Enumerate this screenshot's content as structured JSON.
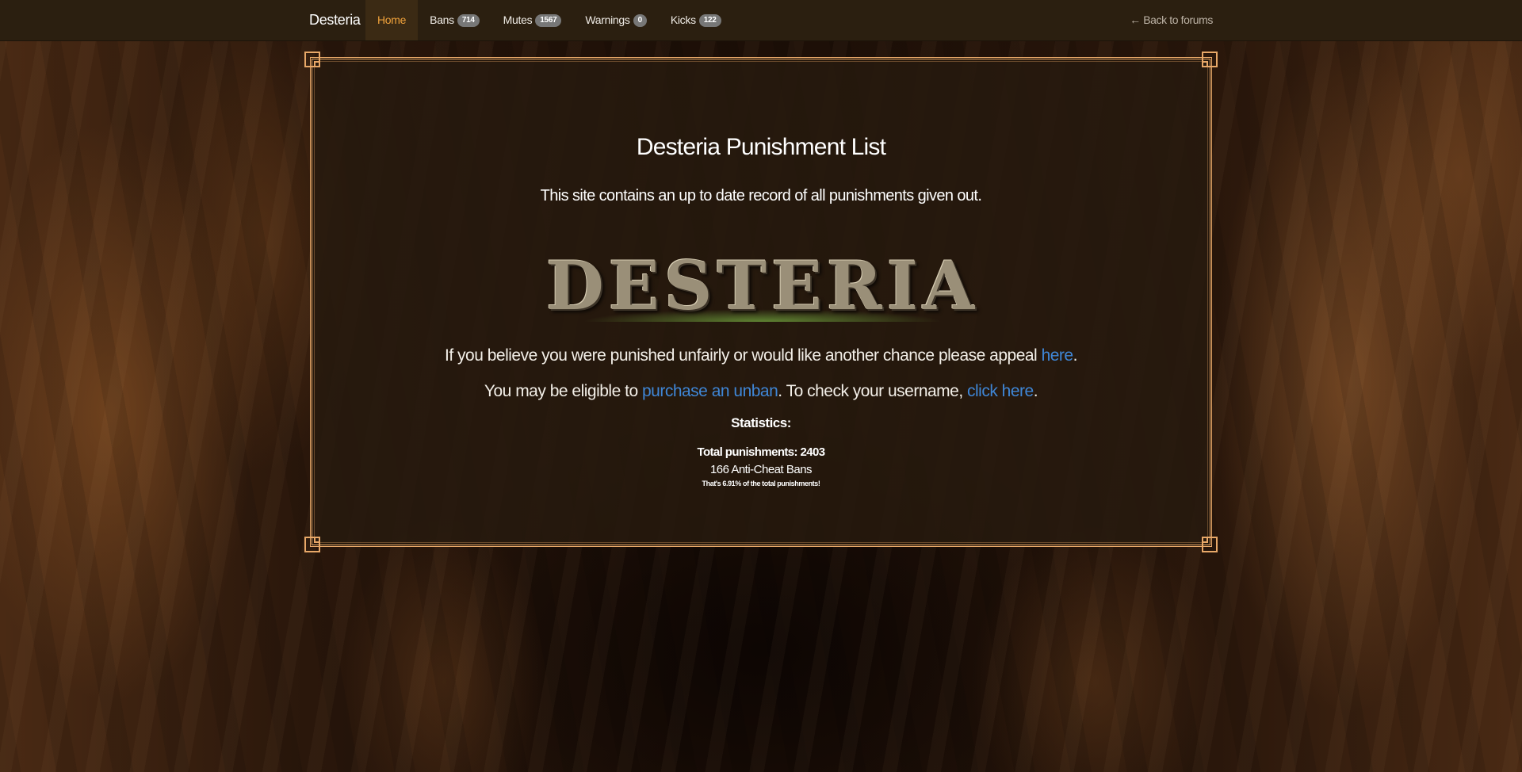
{
  "navbar": {
    "brand": "Desteria",
    "items": [
      {
        "label": "Home",
        "badge": null,
        "active": true
      },
      {
        "label": "Bans",
        "badge": "714",
        "active": false
      },
      {
        "label": "Mutes",
        "badge": "1567",
        "active": false
      },
      {
        "label": "Warnings",
        "badge": "0",
        "active": false
      },
      {
        "label": "Kicks",
        "badge": "122",
        "active": false
      }
    ],
    "back_link": "← Back to forums"
  },
  "main": {
    "title": "Desteria Punishment List",
    "subtitle": "This site contains an up to date record of all punishments given out.",
    "logo_text": "DESTERIA",
    "appeal": {
      "prefix": "If you believe you were punished unfairly or would like another chance please appeal ",
      "link": "here",
      "suffix": "."
    },
    "unban": {
      "prefix": "You may be eligible to ",
      "link1": "purchase an unban",
      "middle": ". To check your username, ",
      "link2": "click here",
      "suffix": "."
    },
    "statistics": {
      "heading": "Statistics:",
      "total": "Total punishments: 2403",
      "anticheat": "166 Anti-Cheat Bans",
      "percent": "That's 6.91% of the total punishments!"
    }
  },
  "colors": {
    "nav_bg": "#2b1f10",
    "active": "#f0a23b",
    "link": "#3f86d6",
    "frame": "#e8a868",
    "badge": "#777777"
  }
}
